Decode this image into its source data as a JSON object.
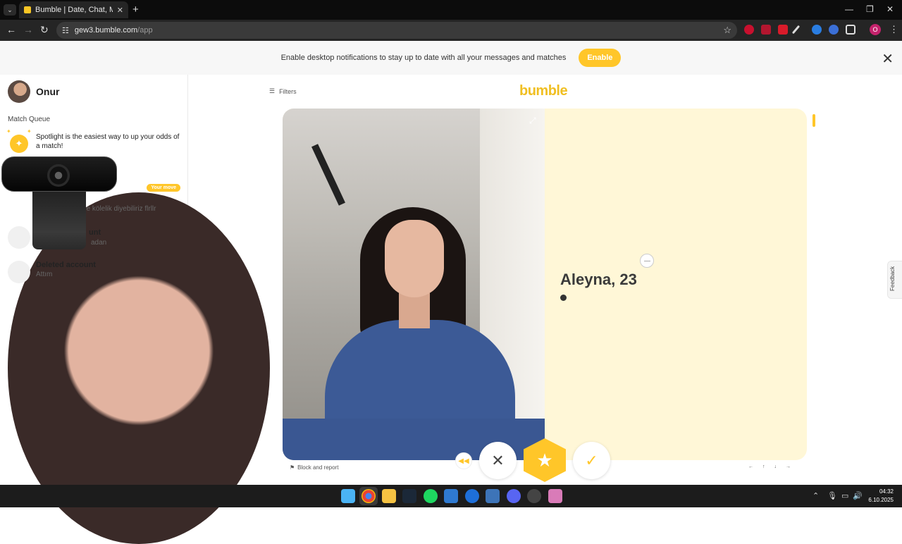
{
  "browser": {
    "tab_title": "Bumble | Date, Chat, Meet New",
    "url_host": "gew3.bumble.com",
    "url_path": "/app",
    "profile_initial": "O"
  },
  "notification": {
    "text": "Enable desktop notifications to stay up to date with all your messages and matches",
    "button": "Enable"
  },
  "sidebar": {
    "user_name": "Onur",
    "match_queue_label": "Match Queue",
    "spotlight_text": "Spotlight is the easiest way to up your odds of a match!",
    "conversations": [
      {
        "snippet": "de kölelik diyebiliriz flrllr",
        "badge": "Your move"
      },
      {
        "name": "unt",
        "snippet": "adan"
      },
      {
        "name": "Deleted account",
        "snippet": "Attım"
      }
    ]
  },
  "main": {
    "filters_label": "Filters",
    "logo_text": "bumble",
    "profile_name": "Aleyna, 23",
    "block_report": "Block and report"
  },
  "feedback_label": "Feedback",
  "taskbar": {
    "time": "04:32",
    "date": "6.10.2025"
  },
  "colors": {
    "brand": "#ffc629",
    "card_bg": "#fff7d7"
  }
}
